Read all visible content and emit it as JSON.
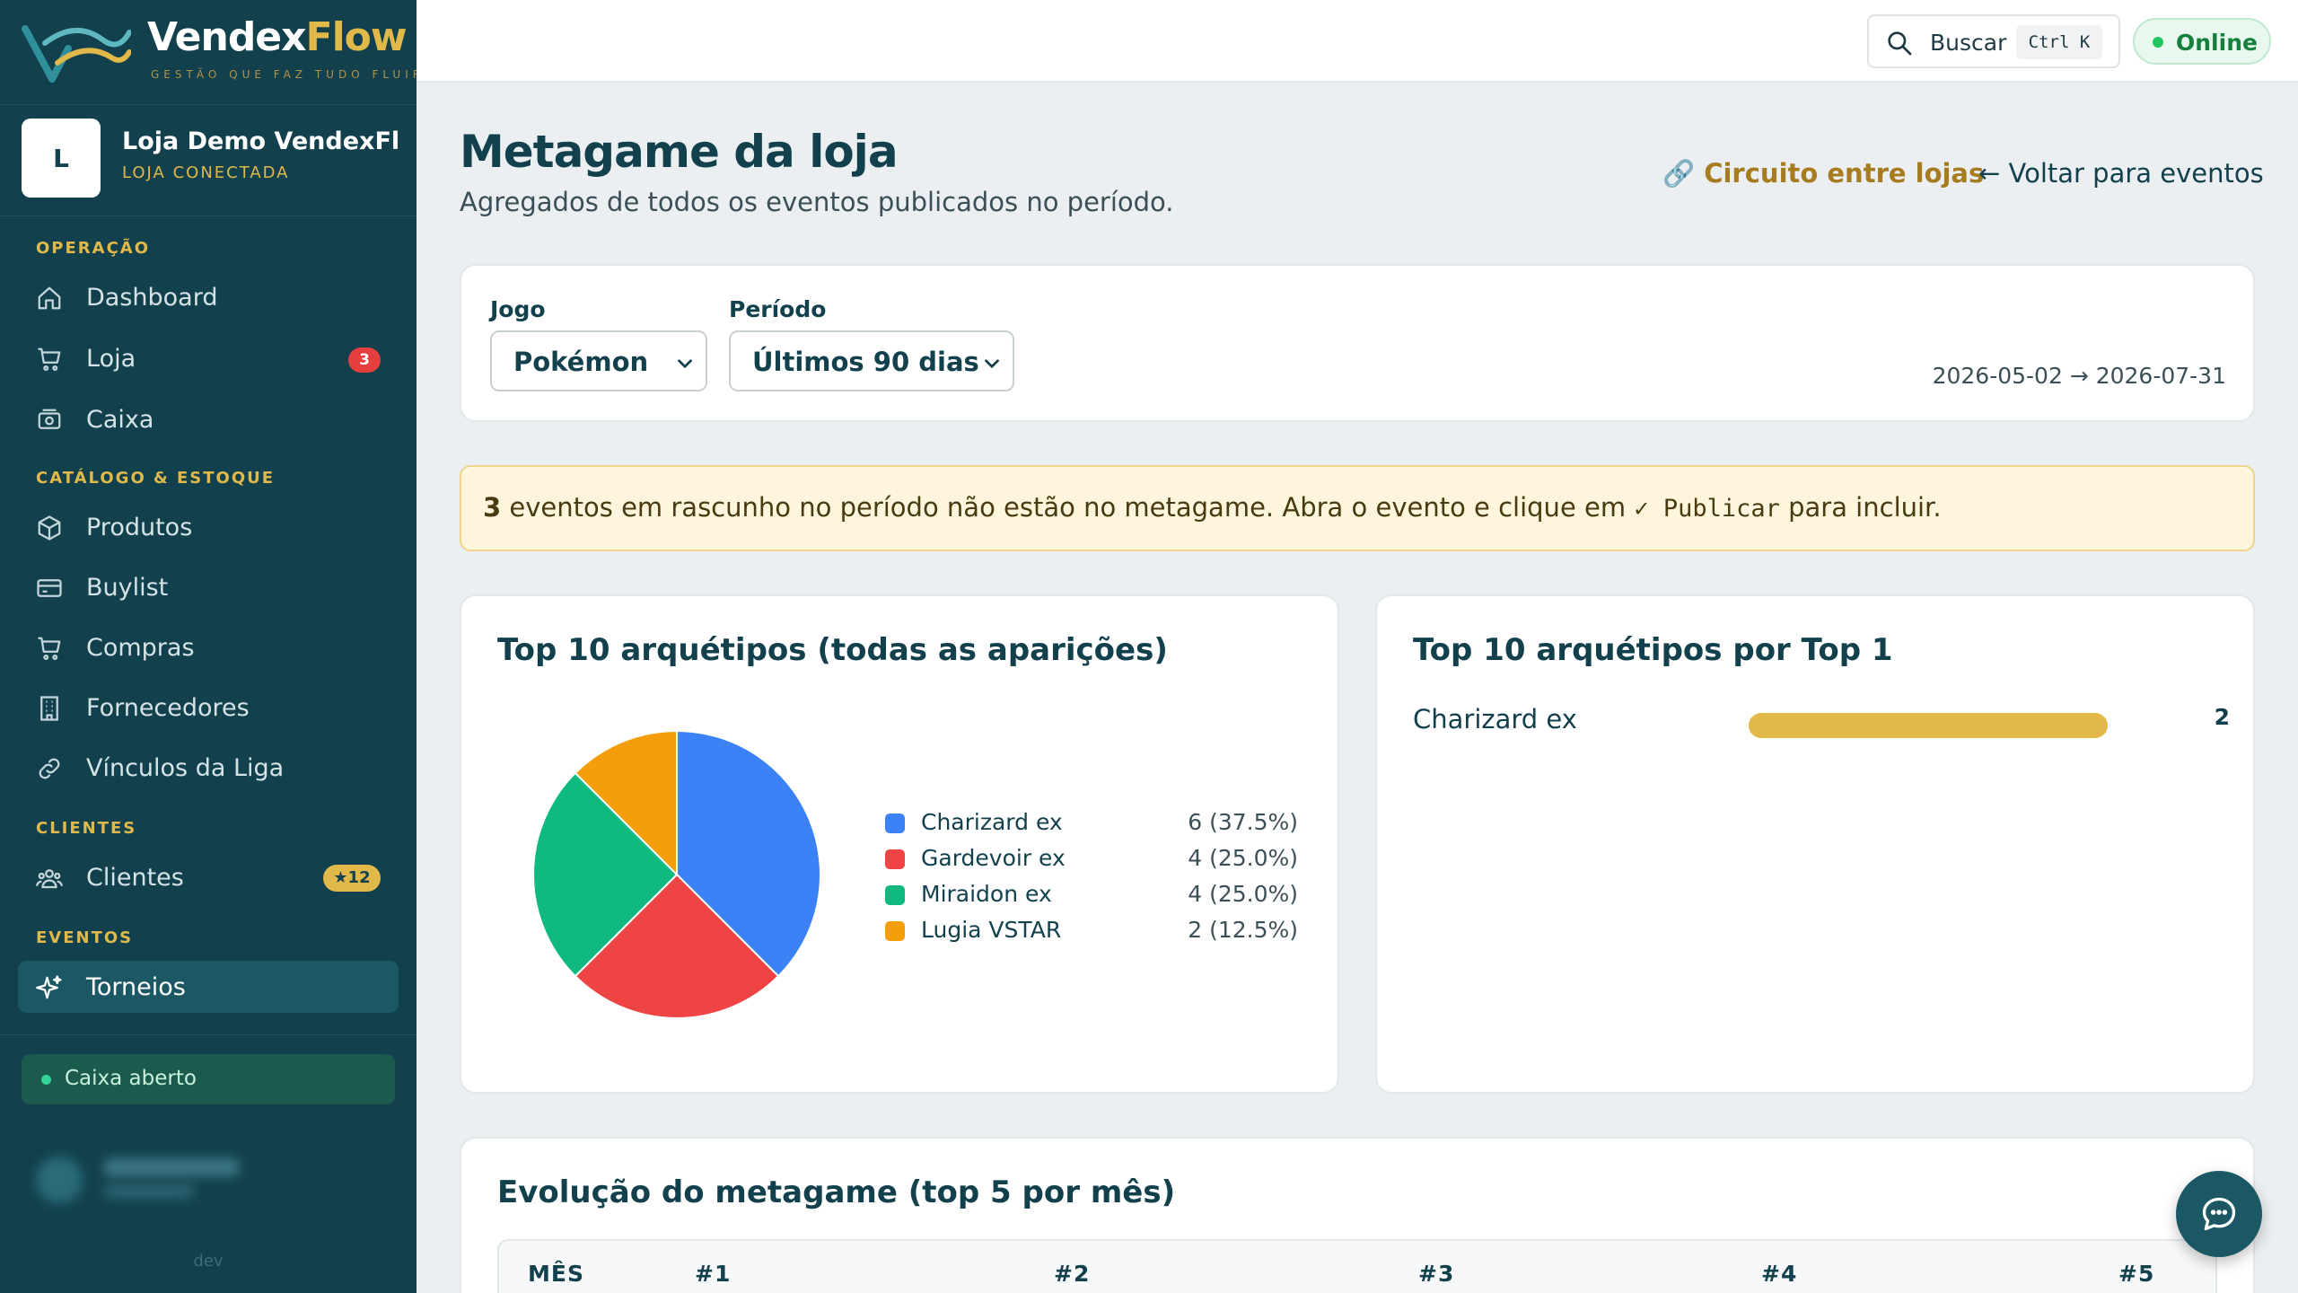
{
  "brand": {
    "name_part1": "Vendex",
    "name_part2": "Flow",
    "tagline": "GESTÃO QUE FAZ TUDO FLUIR"
  },
  "store": {
    "initial": "L",
    "name": "Loja Demo VendexFl...",
    "status": "LOJA CONECTADA"
  },
  "sidebar": {
    "sections": [
      {
        "title": "OPERAÇÃO"
      },
      {
        "title": "CATÁLOGO & ESTOQUE"
      },
      {
        "title": "CLIENTES"
      },
      {
        "title": "EVENTOS"
      }
    ],
    "items": [
      {
        "label": "Dashboard",
        "icon": "home-icon"
      },
      {
        "label": "Loja",
        "icon": "cart-icon",
        "badge": "3"
      },
      {
        "label": "Caixa",
        "icon": "cash-register-icon"
      },
      {
        "label": "Produtos",
        "icon": "box-icon"
      },
      {
        "label": "Buylist",
        "icon": "card-icon"
      },
      {
        "label": "Compras",
        "icon": "cart-icon"
      },
      {
        "label": "Fornecedores",
        "icon": "building-icon"
      },
      {
        "label": "Vínculos da Liga",
        "icon": "link-icon"
      },
      {
        "label": "Clientes",
        "icon": "users-icon",
        "badge": "★12"
      },
      {
        "label": "Torneios",
        "icon": "sparkle-icon",
        "active": true
      }
    ],
    "cash_status": "Caixa aberto",
    "env": "dev"
  },
  "topbar": {
    "search_label": "Buscar",
    "shortcut": "Ctrl K",
    "status": "Online"
  },
  "page": {
    "title": "Metagame da loja",
    "subtitle": "Agregados de todos os eventos publicados no período.",
    "link_circuit": "🔗 Circuito entre lojas",
    "link_back": "← Voltar para eventos"
  },
  "filters": {
    "game_label": "Jogo",
    "game_value": "Pokémon",
    "period_label": "Período",
    "period_value": "Últimos 90 dias",
    "date_range": "2026-05-02 → 2026-07-31"
  },
  "banner": {
    "count": "3",
    "text_before": " eventos em rascunho no período não estão no metagame. Abra o evento e clique em ",
    "code": "✓ Publicar",
    "text_after": " para incluir."
  },
  "pie_card": {
    "title": "Top 10 arquétipos (todas as aparições)"
  },
  "top1_card": {
    "title": "Top 10 arquétipos por Top 1"
  },
  "evolution": {
    "title": "Evolução do metagame (top 5 por mês)",
    "columns": [
      "MÊS",
      "#1",
      "#2",
      "#3",
      "#4",
      "#5"
    ]
  },
  "chart_data": [
    {
      "type": "pie",
      "title": "Top 10 arquétipos (todas as aparições)",
      "categories": [
        "Charizard ex",
        "Gardevoir ex",
        "Miraidon ex",
        "Lugia VSTAR"
      ],
      "values": [
        6,
        4,
        4,
        2
      ],
      "labels": [
        "6 (37.5%)",
        "4 (25.0%)",
        "4 (25.0%)",
        "2 (12.5%)"
      ],
      "colors": [
        "#3b82f6",
        "#ef4444",
        "#10b981",
        "#f59e0b"
      ]
    },
    {
      "type": "bar",
      "title": "Top 10 arquétipos por Top 1",
      "categories": [
        "Charizard ex"
      ],
      "values": [
        2
      ],
      "colors": [
        "#e0b94a"
      ]
    }
  ],
  "colors": {
    "primary": "#12414d",
    "accent": "#e0b94a",
    "online": "#22c55e",
    "danger": "#e53e3e"
  }
}
